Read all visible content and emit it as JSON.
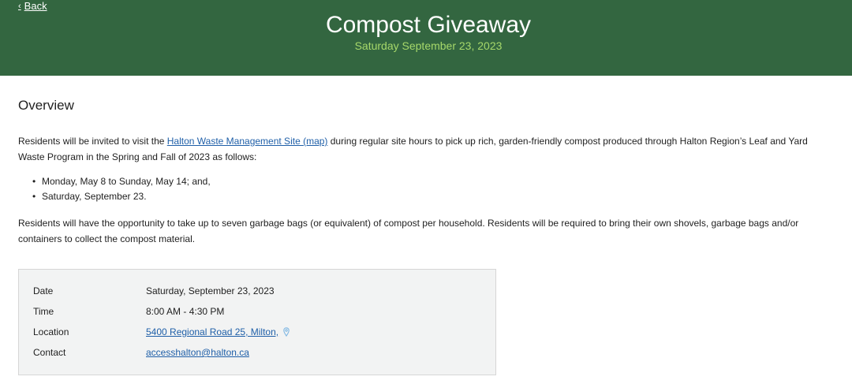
{
  "header": {
    "back_label": "Back",
    "title": "Compost Giveaway",
    "subtitle": "Saturday September 23, 2023"
  },
  "overview": {
    "heading": "Overview",
    "para1_before_link": "Residents will be invited to visit the ",
    "para1_link": "Halton Waste Management Site (map)",
    "para1_after_link": " during regular site hours to pick up rich, garden-friendly compost produced through Halton Region’s Leaf and Yard Waste Program in the Spring and Fall of 2023 as follows:",
    "bullets": [
      "Monday, May 8 to Sunday, May 14; and,",
      "Saturday, September 23."
    ],
    "para2": "Residents will have the opportunity to take up to seven garbage bags (or equivalent) of compost per household. Residents will be required to bring their own shovels, garbage bags and/or containers to collect the compost material."
  },
  "details": {
    "date_label": "Date",
    "date_value": "Saturday, September 23, 2023",
    "time_label": "Time",
    "time_value": "8:00 AM - 4:30 PM",
    "location_label": "Location",
    "location_value": "5400 Regional Road 25, Milton,",
    "contact_label": "Contact",
    "contact_value": "accesshalton@halton.ca"
  },
  "colors": {
    "header_bg": "#336640",
    "subtitle": "#a6d86a",
    "link": "#1f5fa8"
  }
}
